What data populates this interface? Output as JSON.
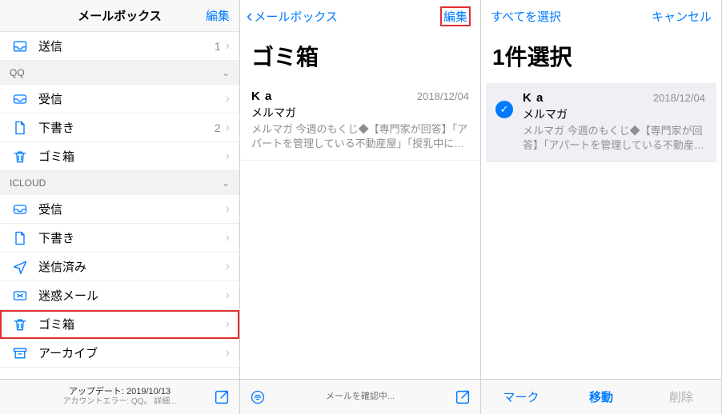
{
  "pane1": {
    "title": "メールボックス",
    "edit": "編集",
    "rows_top": [
      {
        "icon": "tray-out",
        "label": "送信",
        "count": "1"
      }
    ],
    "section_qq": "QQ",
    "rows_qq": [
      {
        "icon": "inbox",
        "label": "受信",
        "count": ""
      },
      {
        "icon": "doc",
        "label": "下書き",
        "count": "2"
      },
      {
        "icon": "trash",
        "label": "ゴミ箱",
        "count": ""
      }
    ],
    "section_icloud": "ICLOUD",
    "rows_icloud": [
      {
        "icon": "inbox",
        "label": "受信"
      },
      {
        "icon": "doc",
        "label": "下書き"
      },
      {
        "icon": "plane",
        "label": "送信済み"
      },
      {
        "icon": "junk",
        "label": "迷惑メール"
      },
      {
        "icon": "trash",
        "label": "ゴミ箱"
      },
      {
        "icon": "archive",
        "label": "アーカイブ"
      }
    ],
    "footer": {
      "line1": "アップデート: 2019/10/13",
      "line2": "アカウントエラー: QQ。 詳細..."
    }
  },
  "pane2": {
    "back": "メールボックス",
    "edit": "編集",
    "title": "ゴミ箱",
    "msg": {
      "from": "K a",
      "date": "2018/12/04",
      "subject": "メルマガ",
      "preview": "メルマガ 今週のもくじ◆【専門家が回答】「アパートを管理している不動産屋」「授乳中に風邪を引…"
    },
    "footer_status": "メールを確認中..."
  },
  "pane3": {
    "select_all": "すべてを選択",
    "cancel": "キャンセル",
    "title": "1件選択",
    "msg": {
      "from": "K a",
      "date": "2018/12/04",
      "subject": "メルマガ",
      "preview": "メルマガ 今週のもくじ◆【専門家が回答】「アパートを管理している不動産屋」「…"
    },
    "actions": {
      "mark": "マーク",
      "move": "移動",
      "delete": "削除"
    }
  }
}
